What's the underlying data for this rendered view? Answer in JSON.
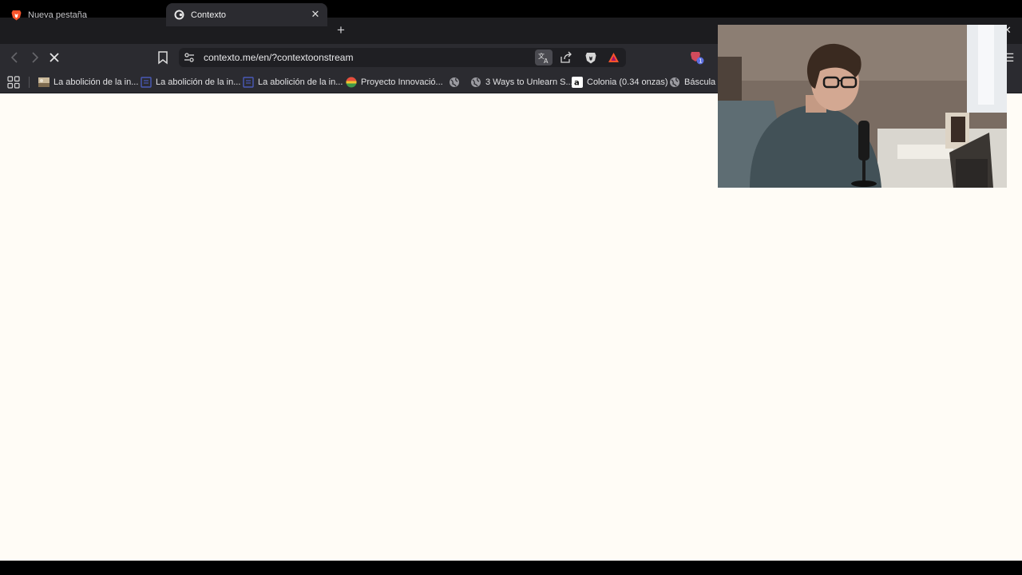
{
  "tabs": [
    {
      "title": "Nueva pestaña",
      "icon": "brave-lion-icon",
      "active": false
    },
    {
      "title": "Contexto",
      "icon": "contexto-icon",
      "active": true
    }
  ],
  "toolbar": {
    "url": "contexto.me/en/?contextoonstream",
    "loading": true
  },
  "bookmarks": [
    {
      "label": "La abolición de la in...",
      "icon": "image-favicon-icon"
    },
    {
      "label": "La abolición de la in...",
      "icon": "doc-favicon-icon"
    },
    {
      "label": "La abolición de la in...",
      "icon": "doc-favicon-icon"
    },
    {
      "label": "Proyecto Innovació...",
      "icon": "colorful-globe-icon"
    },
    {
      "label": "",
      "icon": "globe-icon"
    },
    {
      "label": "3 Ways to Unlearn S...",
      "icon": "globe-icon"
    },
    {
      "label": "Colonia (0.34 onzas)",
      "icon": "amazon-icon"
    },
    {
      "label": "Báscula d",
      "icon": "globe-icon"
    }
  ],
  "extensions": {
    "badge_count": "1"
  },
  "colors": {
    "page_background": "#fffcf6",
    "toolbar": "#2b2b30",
    "tabstrip": "#1c1c1f",
    "brave_orange": "#fb542b"
  }
}
